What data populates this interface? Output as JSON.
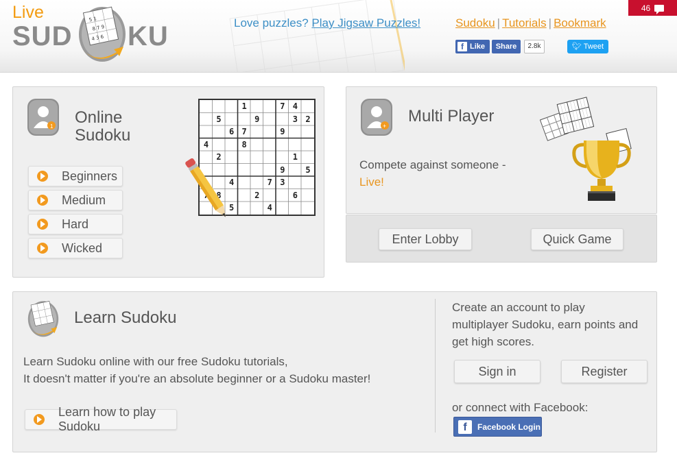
{
  "header": {
    "logo": {
      "live": "Live",
      "sud": "SUD",
      "ku": "KU"
    },
    "promo_text": "Love puzzles?",
    "promo_link": "Play Jigsaw Puzzles!",
    "links": [
      "Sudoku",
      "Tutorials",
      "Bookmark"
    ],
    "separator": "|",
    "fb_like": "Like",
    "fb_share": "Share",
    "share_count": "2.8k",
    "tweet": "Tweet",
    "comment_count": "46"
  },
  "online": {
    "title_line1": "Online",
    "title_line2": "Sudoku",
    "levels": [
      "Beginners",
      "Medium",
      "Hard",
      "Wicked"
    ],
    "grid_rows": [
      "...1..74.",
      ".5..9..32",
      "..67..9..",
      "4..8.....",
      ".2.....1.",
      "......9.5",
      "..4..73..",
      "78..2..6.",
      "..5..4..."
    ]
  },
  "multiplayer": {
    "title": "Multi Player",
    "desc": "Compete against someone -",
    "live": "Live!",
    "enter_lobby": "Enter Lobby",
    "quick_game": "Quick Game"
  },
  "learn": {
    "title": "Learn Sudoku",
    "line1": "Learn Sudoku online with our free Sudoku tutorials,",
    "line2": "It doesn't matter if you're an absolute beginner or a Sudoku master!",
    "button": "Learn how to play Sudoku"
  },
  "account": {
    "line1": "Create an account to play",
    "line2": "multiplayer Sudoku, earn points and",
    "line3": "get high scores.",
    "sign_in": "Sign in",
    "register": "Register",
    "connect": "or connect with Facebook:",
    "fb_login": "Facebook Login"
  },
  "colors": {
    "accent": "#e8951f",
    "link": "#3d8fc6",
    "facebook": "#4267b2",
    "twitter": "#1da1f2",
    "badge": "#c8102e"
  }
}
